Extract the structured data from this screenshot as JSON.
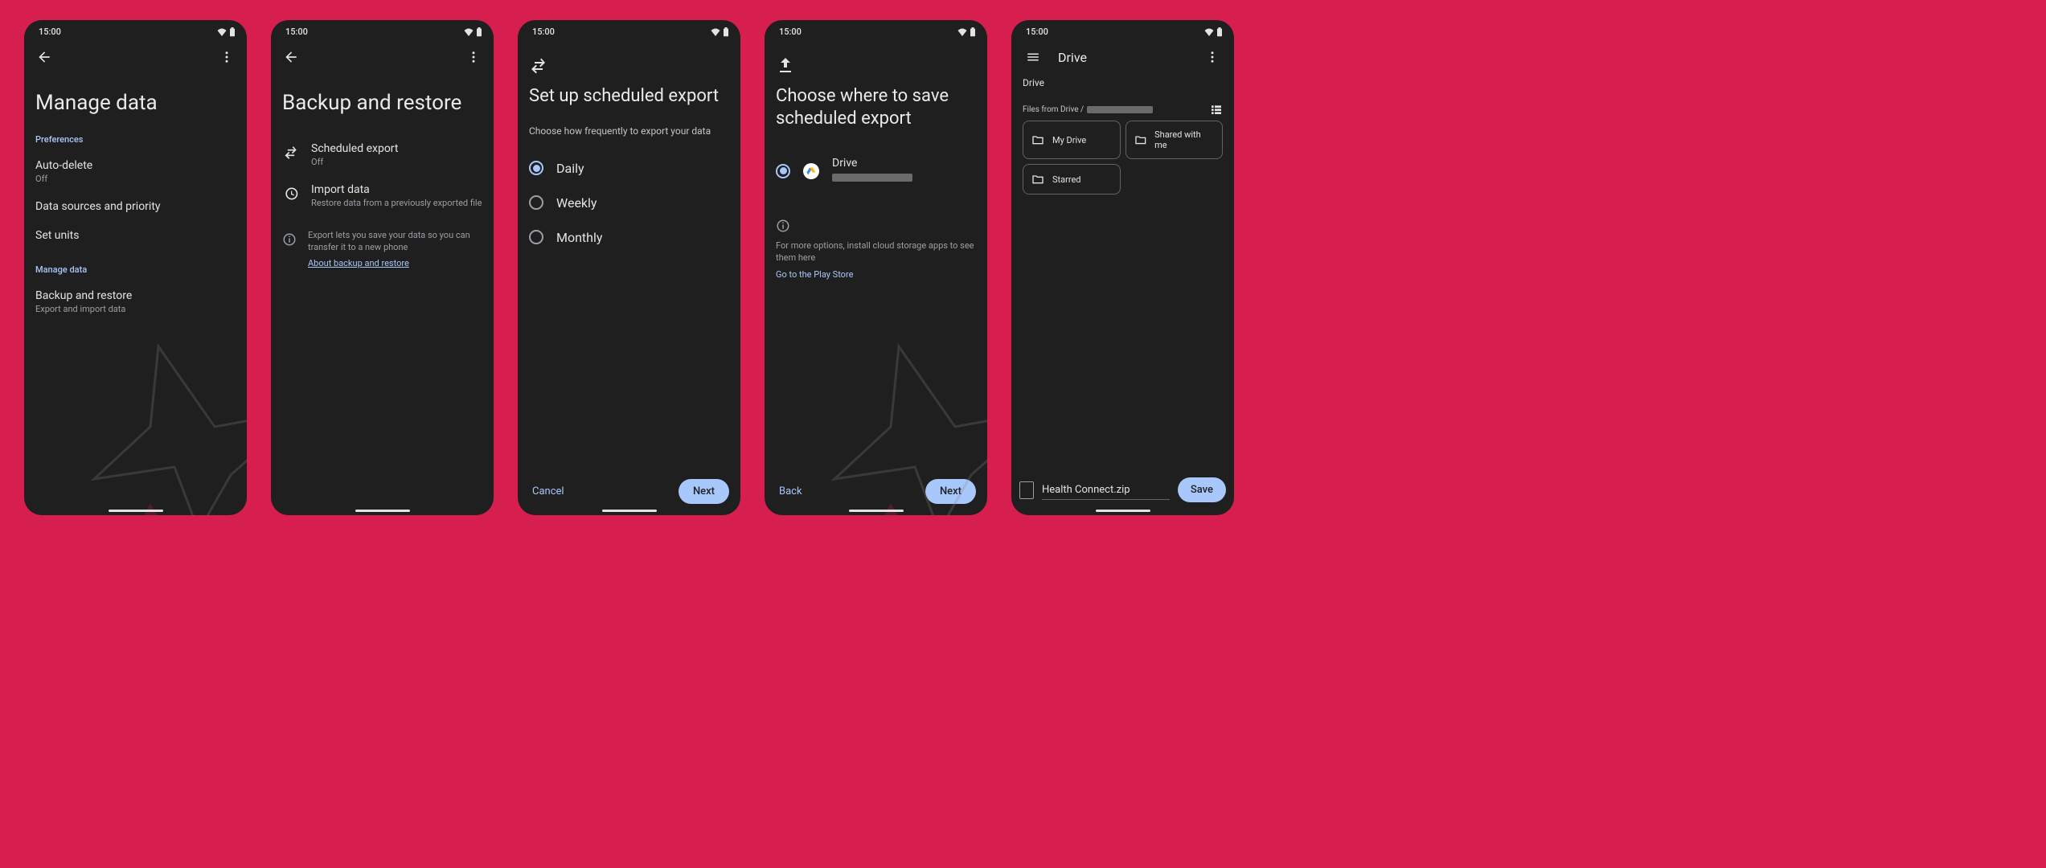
{
  "status": {
    "time": "15:00"
  },
  "screen1": {
    "title": "Manage data",
    "section1": "Preferences",
    "items1": [
      {
        "title": "Auto-delete",
        "sub": "Off"
      },
      {
        "title": "Data sources and priority",
        "sub": ""
      },
      {
        "title": "Set units",
        "sub": ""
      }
    ],
    "section2": "Manage data",
    "items2": [
      {
        "title": "Backup and restore",
        "sub": "Export and import data"
      }
    ]
  },
  "screen2": {
    "title": "Backup and restore",
    "items": [
      {
        "title": "Scheduled export",
        "sub": "Off"
      },
      {
        "title": "Import data",
        "sub": "Restore data from a previously exported file"
      }
    ],
    "info": "Export lets you save your data so you can transfer it to a new phone",
    "link": "About backup and restore"
  },
  "screen3": {
    "title": "Set up scheduled export",
    "hint": "Choose how frequently to export your data",
    "options": [
      "Daily",
      "Weekly",
      "Monthly"
    ],
    "selected": 0,
    "cancel": "Cancel",
    "next": "Next"
  },
  "screen4": {
    "title": "Choose where to save scheduled export",
    "option_label": "Drive",
    "info": "For more options, install cloud storage apps to see them here",
    "link": "Go to the Play Store",
    "back": "Back",
    "next": "Next"
  },
  "screen5": {
    "app_title": "Drive",
    "breadcrumb_root": "Drive",
    "breadcrumb_prefix": "Files from Drive /",
    "folders": [
      "My Drive",
      "Shared with me",
      "Starred"
    ],
    "filename": "Health Connect.zip",
    "save": "Save"
  }
}
